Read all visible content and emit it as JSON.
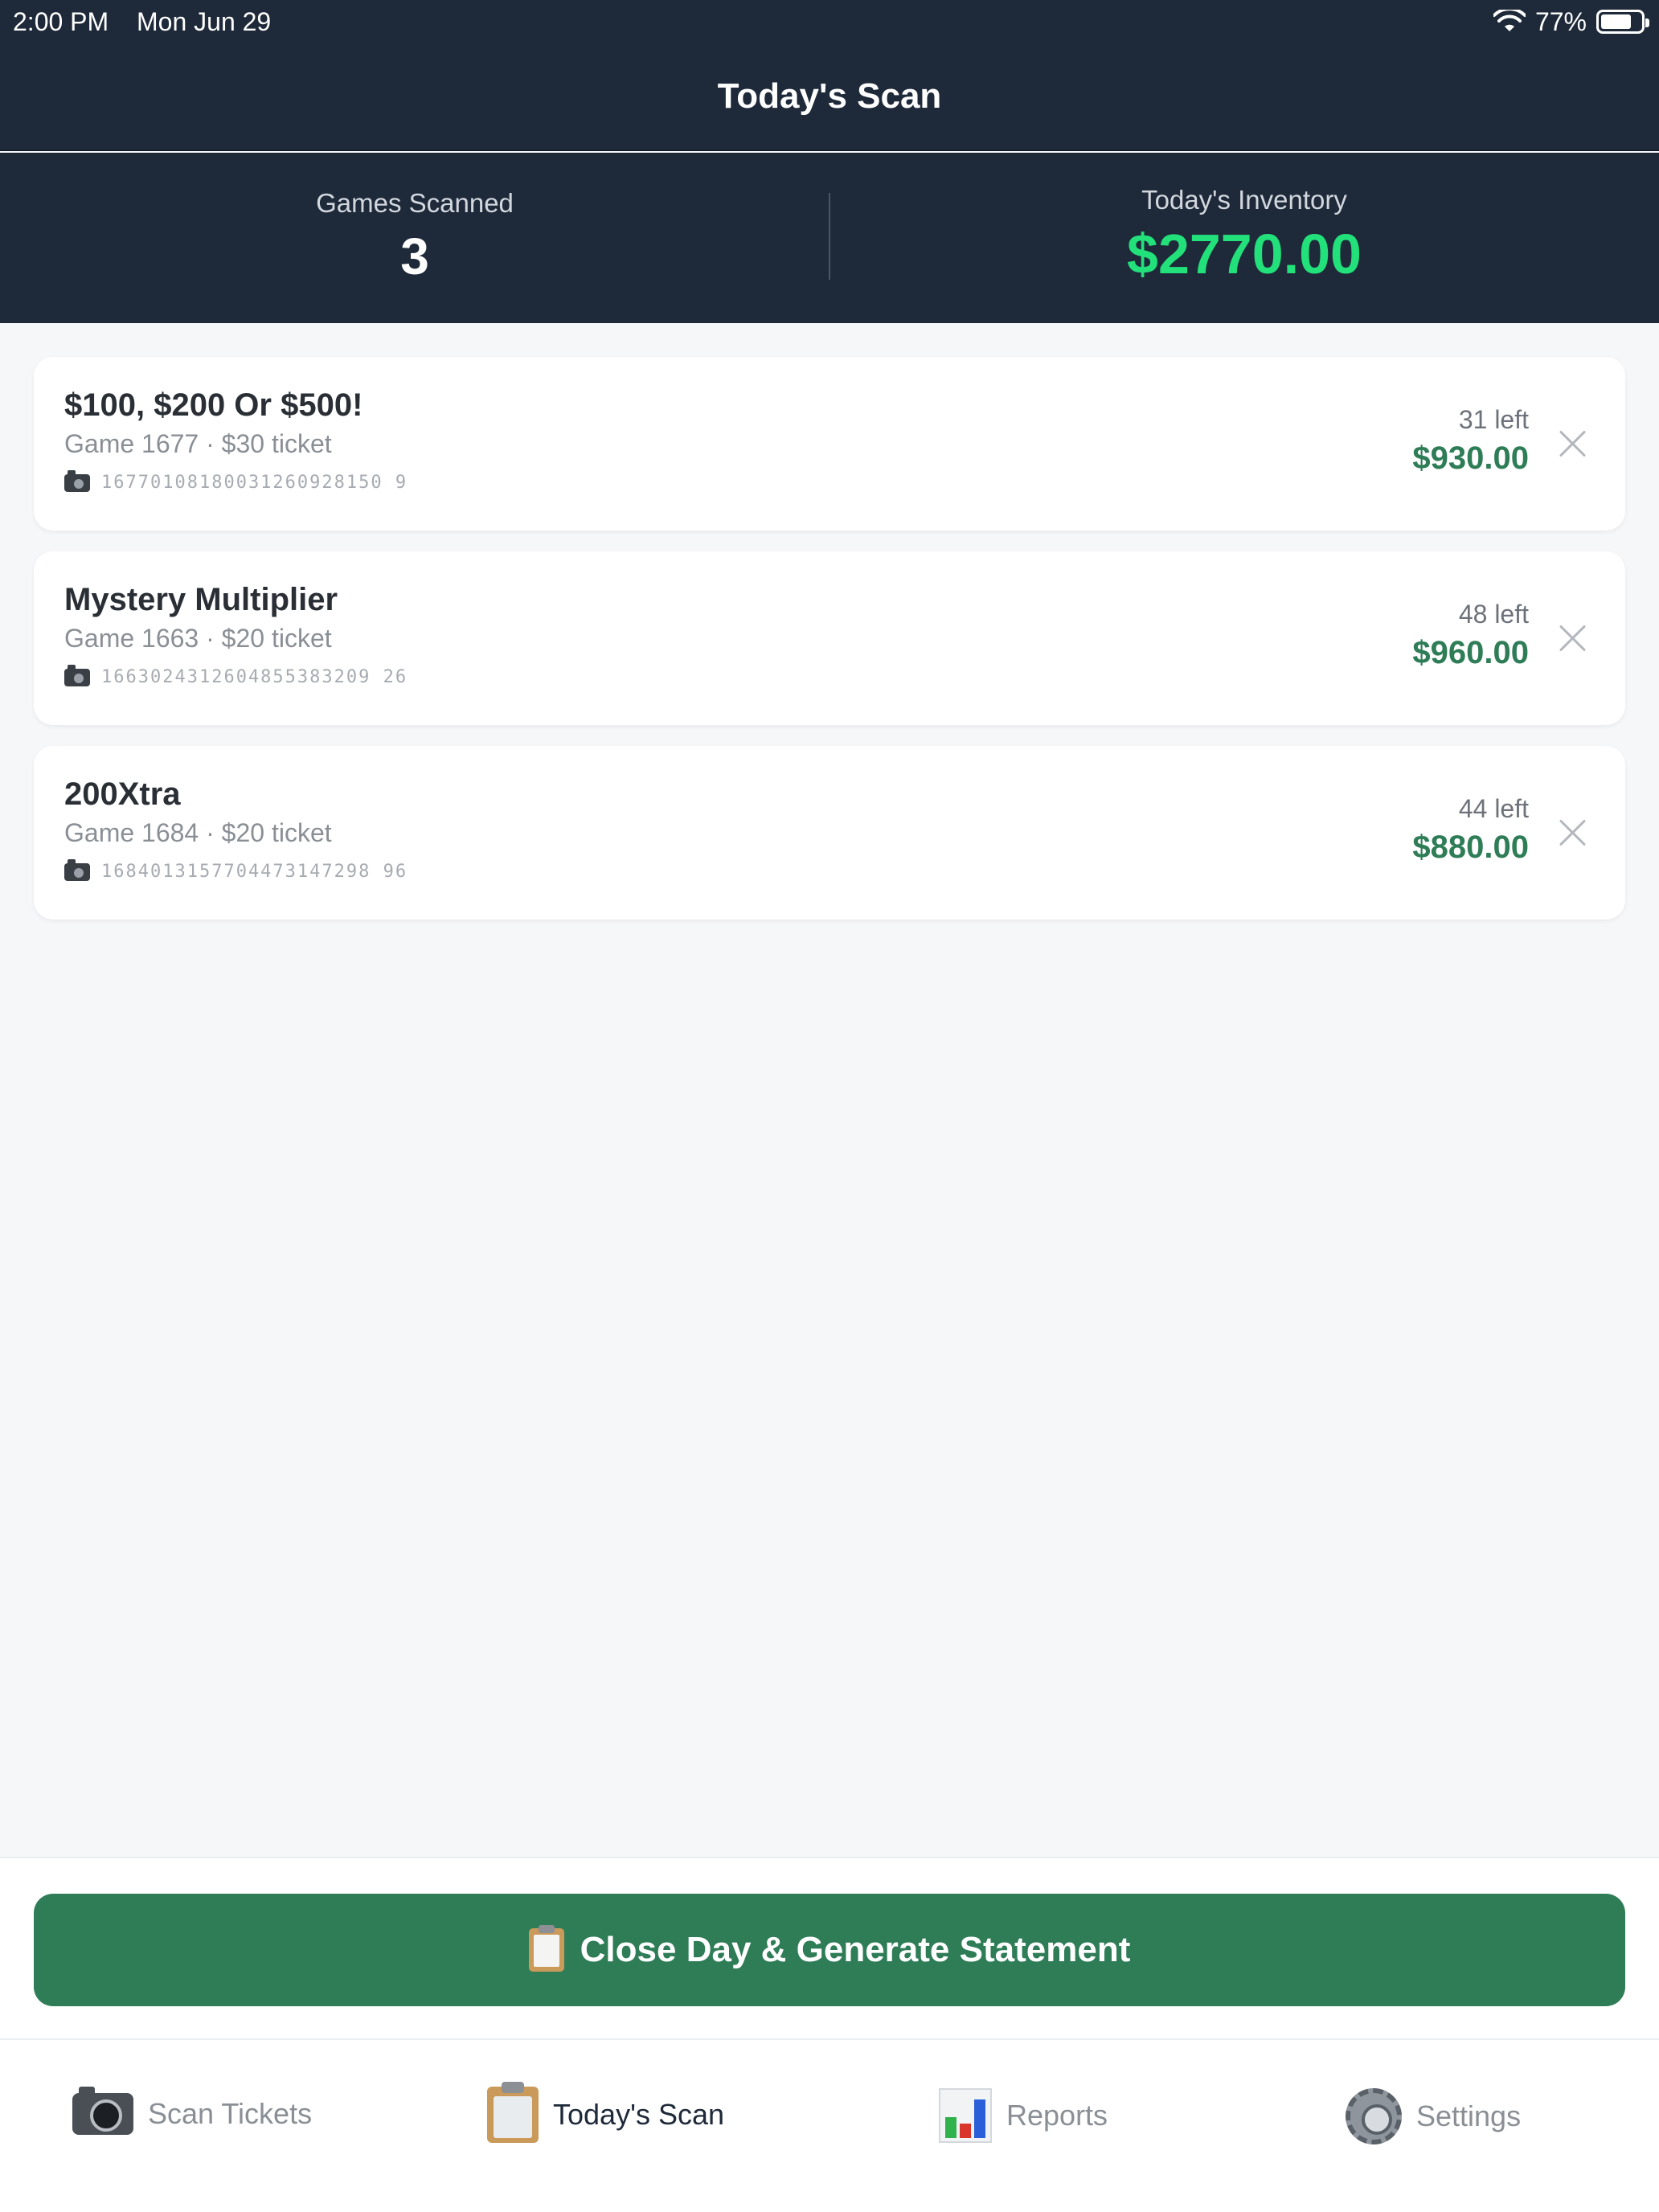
{
  "status_bar": {
    "time": "2:00 PM",
    "date": "Mon Jun 29",
    "battery": "77%",
    "battery_level": 0.77
  },
  "header": {
    "title": "Today's Scan"
  },
  "summary": {
    "games_label": "Games Scanned",
    "games_value": "3",
    "inventory_label": "Today's Inventory",
    "inventory_value": "$2770.00"
  },
  "games": [
    {
      "name": "$100, $200 Or $500!",
      "meta": "Game 1677 · $30 ticket",
      "barcode": "16770108180031260928150 9",
      "left": "31 left",
      "amount": "$930.00"
    },
    {
      "name": "Mystery Multiplier",
      "meta": "Game 1663 · $20 ticket",
      "barcode": "1663024312604855383209 26",
      "left": "48 left",
      "amount": "$960.00"
    },
    {
      "name": "200Xtra",
      "meta": "Game 1684 · $20 ticket",
      "barcode": "1684013157704473147298 96",
      "left": "44 left",
      "amount": "$880.00"
    }
  ],
  "actions": {
    "close_day_label": "Close Day & Generate Statement"
  },
  "tabs": [
    {
      "label": "Scan Tickets",
      "icon": "camera-icon"
    },
    {
      "label": "Today's Scan",
      "icon": "clipboard-icon"
    },
    {
      "label": "Reports",
      "icon": "bar-chart-icon"
    },
    {
      "label": "Settings",
      "icon": "gear-icon"
    }
  ],
  "colors": {
    "header_bg": "#1e2939",
    "accent_green": "#2e7d57",
    "inventory_green": "#22e07a"
  }
}
